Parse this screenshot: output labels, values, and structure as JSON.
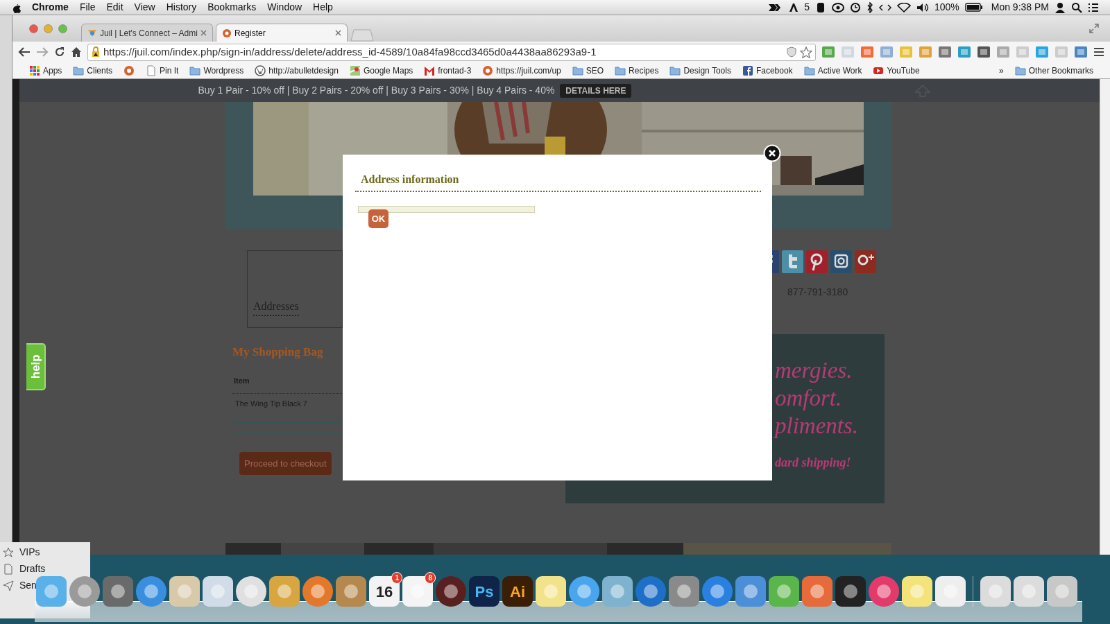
{
  "menu_bar": {
    "app": "Chrome",
    "menus": [
      "File",
      "Edit",
      "View",
      "History",
      "Bookmarks",
      "Window",
      "Help"
    ],
    "status": {
      "count": "5",
      "battery": "100%",
      "clock": "Mon 9:38 PM"
    }
  },
  "browser": {
    "tabs": [
      {
        "title": "Juil | Let's Connect – Admi",
        "selected": false
      },
      {
        "title": "Register",
        "selected": true
      }
    ],
    "url": "https://juil.com/index.php/sign-in/address/delete/address_id-4589/10a84fa98ccd3465d0a4438aa86293a9-1",
    "bookmarks": [
      {
        "label": "Apps",
        "kind": "apps"
      },
      {
        "label": "Clients",
        "kind": "folder"
      },
      {
        "kind": "site"
      },
      {
        "label": "Pin It",
        "kind": "page"
      },
      {
        "label": "Wordpress",
        "kind": "folder"
      },
      {
        "label": "http://abulletdesign",
        "kind": "wordpress"
      },
      {
        "label": "Google Maps",
        "kind": "maps"
      },
      {
        "label": "frontad-3",
        "kind": "gmail"
      },
      {
        "label": "https://juil.com/up",
        "kind": "site"
      },
      {
        "label": "SEO",
        "kind": "folder"
      },
      {
        "label": "Recipes",
        "kind": "folder"
      },
      {
        "label": "Design Tools",
        "kind": "folder"
      },
      {
        "label": "Facebook",
        "kind": "facebook"
      },
      {
        "label": "Active Work",
        "kind": "folder"
      },
      {
        "label": "YouTube",
        "kind": "youtube"
      }
    ],
    "bookmarks_overflow": "»",
    "other_bookmarks": "Other Bookmarks"
  },
  "page": {
    "promo": "Buy 1 Pair - 10% off | Buy 2 Pairs - 20% off | Buy 3 Pairs - 30% | Buy 4 Pairs - 40%",
    "promo_button": "DETAILS HERE",
    "addresses_heading": "Addresses",
    "bag": {
      "title": "My Shopping Bag",
      "column": "Item",
      "rows": [
        "The Wing Tip Black 7"
      ],
      "checkout": "Proceed to checkout"
    },
    "phone": "877-791-3180",
    "banner_lines": [
      "mergies.",
      "omfort.",
      "pliments."
    ],
    "banner_note": "dard shipping!",
    "help_tab": "help"
  },
  "modal": {
    "title": "Address information",
    "button": "OK"
  },
  "mail_sidebar": [
    "VIPs",
    "Drafts",
    "Sen"
  ],
  "dock": [
    {
      "kind": "finder"
    },
    {
      "kind": "rocket"
    },
    {
      "kind": "photos"
    },
    {
      "kind": "safari"
    },
    {
      "kind": "stamp"
    },
    {
      "kind": "xcode"
    },
    {
      "kind": "chrome"
    },
    {
      "kind": "frame"
    },
    {
      "kind": "firefox"
    },
    {
      "kind": "contacts"
    },
    {
      "kind": "calendar",
      "text": "16",
      "badge": "1"
    },
    {
      "kind": "reminders",
      "badge": "8"
    },
    {
      "kind": "compass"
    },
    {
      "kind": "ps",
      "text": "Ps"
    },
    {
      "kind": "ai",
      "text": "Ai"
    },
    {
      "kind": "notes"
    },
    {
      "kind": "messages"
    },
    {
      "kind": "camera"
    },
    {
      "kind": "music"
    },
    {
      "kind": "gear"
    },
    {
      "kind": "store"
    },
    {
      "kind": "word"
    },
    {
      "kind": "excel"
    },
    {
      "kind": "ppt"
    },
    {
      "kind": "printer"
    },
    {
      "kind": "skitch"
    },
    {
      "kind": "stickies"
    },
    {
      "kind": "textedit"
    },
    {
      "kind": "divider"
    },
    {
      "kind": "window"
    },
    {
      "kind": "window"
    },
    {
      "kind": "trash"
    }
  ]
}
